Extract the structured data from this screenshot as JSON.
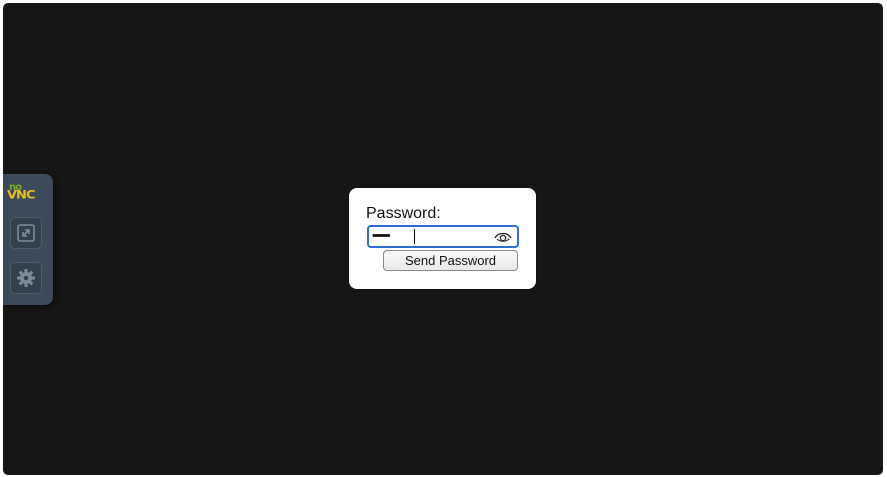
{
  "control_bar": {
    "logo_no": "no",
    "logo_vnc": "VNC",
    "buttons": [
      {
        "icon": "fullscreen-icon"
      },
      {
        "icon": "gear-icon"
      }
    ]
  },
  "dialog": {
    "label": "Password:",
    "password_masked": "•••••••••",
    "show_password_icon": "eye-icon",
    "send_label": "Send Password"
  },
  "colors": {
    "screen_bg": "#161616",
    "control_bar_bg": "#3c4a59",
    "logo_green": "#7aa830",
    "logo_yellow": "#e8c020",
    "focus_ring": "#2d6fd0"
  }
}
